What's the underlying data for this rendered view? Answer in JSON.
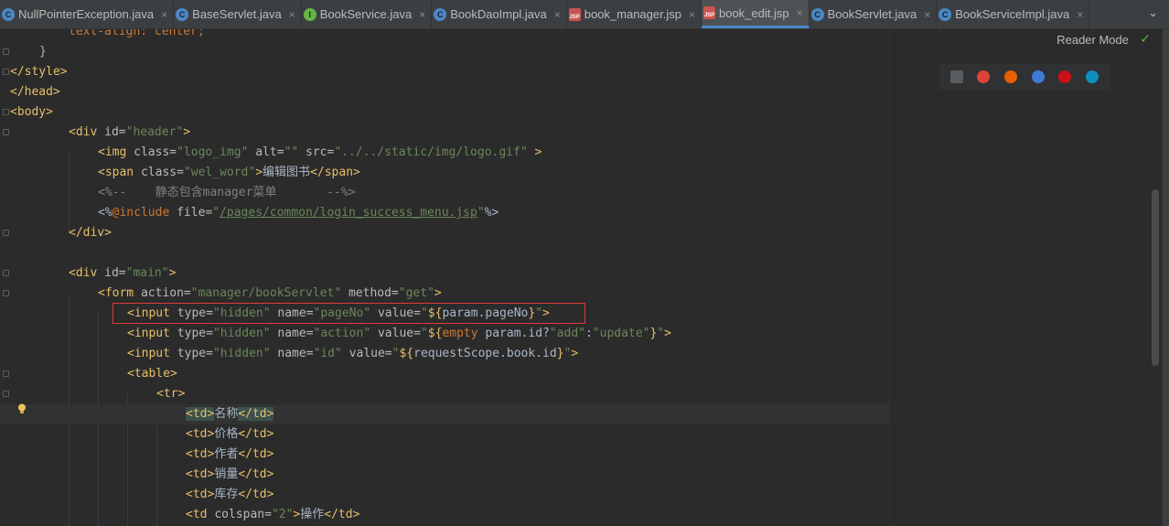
{
  "tabs": [
    {
      "label": "NullPointerException.java",
      "icon": "class-icon",
      "active": false
    },
    {
      "label": "BaseServlet.java",
      "icon": "class-icon",
      "active": false
    },
    {
      "label": "BookService.java",
      "icon": "interface-icon",
      "active": false
    },
    {
      "label": "BookDaoImpl.java",
      "icon": "class-icon",
      "active": false
    },
    {
      "label": "book_manager.jsp",
      "icon": "jsp-icon",
      "active": false
    },
    {
      "label": "book_edit.jsp",
      "icon": "jsp-icon",
      "active": true
    },
    {
      "label": "BookServlet.java",
      "icon": "class-icon",
      "active": false
    },
    {
      "label": "BookServiceImpl.java",
      "icon": "class-icon",
      "active": false
    }
  ],
  "tab_more_icon": "chevron-down-icon",
  "close_glyph": "×",
  "jsp_badge": "JSP",
  "reader_mode": "Reader Mode",
  "colors": {
    "tag": "#e8bf6a",
    "attribute": "#bababa",
    "value": "#6a8759",
    "comment": "#808080",
    "keyword": "#cc7832",
    "highlight_box": "#e53935"
  },
  "code": {
    "l01": {
      "a": "text-align: ",
      "b": "center",
      "c": ";"
    },
    "l02": "}",
    "l03": "</style>",
    "l04": "</head>",
    "l05": "<body>",
    "l06": {
      "t1": "<div ",
      "a1": "id=",
      "v1": "\"header\"",
      "t2": ">"
    },
    "l07": {
      "t1": "<img ",
      "a1": "class=",
      "v1": "\"logo_img\"",
      "a2": " alt=",
      "v2": "\"\"",
      "a3": " src=",
      "v3": "\"../../static/img/logo.gif\"",
      "t2": " >"
    },
    "l08": {
      "t1": "<span ",
      "a1": "class=",
      "v1": "\"wel_word\"",
      "t2": ">",
      "text": "编辑图书",
      "t3": "</span>"
    },
    "l09": "<%--    静态包含manager菜单       --%>",
    "l10": {
      "p1": "<%",
      "k": "@include",
      "a1": " file=",
      "v1": "\"",
      "v2": "/pages/common/login_success_menu.jsp",
      "v3": "\"",
      "p2": "%>"
    },
    "l11": "</div>",
    "l13": {
      "t1": "<div ",
      "a1": "id=",
      "v1": "\"main\"",
      "t2": ">"
    },
    "l14": {
      "t1": "<form ",
      "a1": "action=",
      "v1": "\"manager/bookServlet\"",
      "a2": " method=",
      "v2": "\"get\"",
      "t2": ">"
    },
    "l15": {
      "t1": "<input ",
      "a1": "type=",
      "v1": "\"hidden\"",
      "a2": " name=",
      "v2": "\"pageNo\"",
      "a3": " value=",
      "v3": "\"",
      "e1": "${",
      "e2": "param.pageNo",
      "e3": "}",
      "v4": "\"",
      "t2": ">"
    },
    "l16": {
      "t1": "<input ",
      "a1": "type=",
      "v1": "\"hidden\"",
      "a2": " name=",
      "v2": "\"action\"",
      "a3": " value=",
      "v3": "\"",
      "e1": "${",
      "k": "empty",
      "e2": " param.id?",
      "v5": "\"add\"",
      "e4": ":",
      "v6": "\"update\"",
      "e3": "}",
      "v4": "\"",
      "t2": ">"
    },
    "l17": {
      "t1": "<input ",
      "a1": "type=",
      "v1": "\"hidden\"",
      "a2": " name=",
      "v2": "\"id\"",
      "a3": " value=",
      "v3": "\"",
      "e1": "${",
      "e2": "requestScope.book.id",
      "e3": "}",
      "v4": "\"",
      "t2": ">"
    },
    "l18": "<table>",
    "l19": "<tr>",
    "l20": {
      "t1": "<td>",
      "text": "名称",
      "t2": "</td>"
    },
    "l21": {
      "t1": "<td>",
      "text": "价格",
      "t2": "</td>"
    },
    "l22": {
      "t1": "<td>",
      "text": "作者",
      "t2": "</td>"
    },
    "l23": {
      "t1": "<td>",
      "text": "销量",
      "t2": "</td>"
    },
    "l24": {
      "t1": "<td>",
      "text": "库存",
      "t2": "</td>"
    },
    "l25": {
      "t1": "<td ",
      "a1": "colspan=",
      "v1": "\"2\"",
      "t2": ">",
      "text": "操作",
      "t3": "</td>"
    }
  }
}
